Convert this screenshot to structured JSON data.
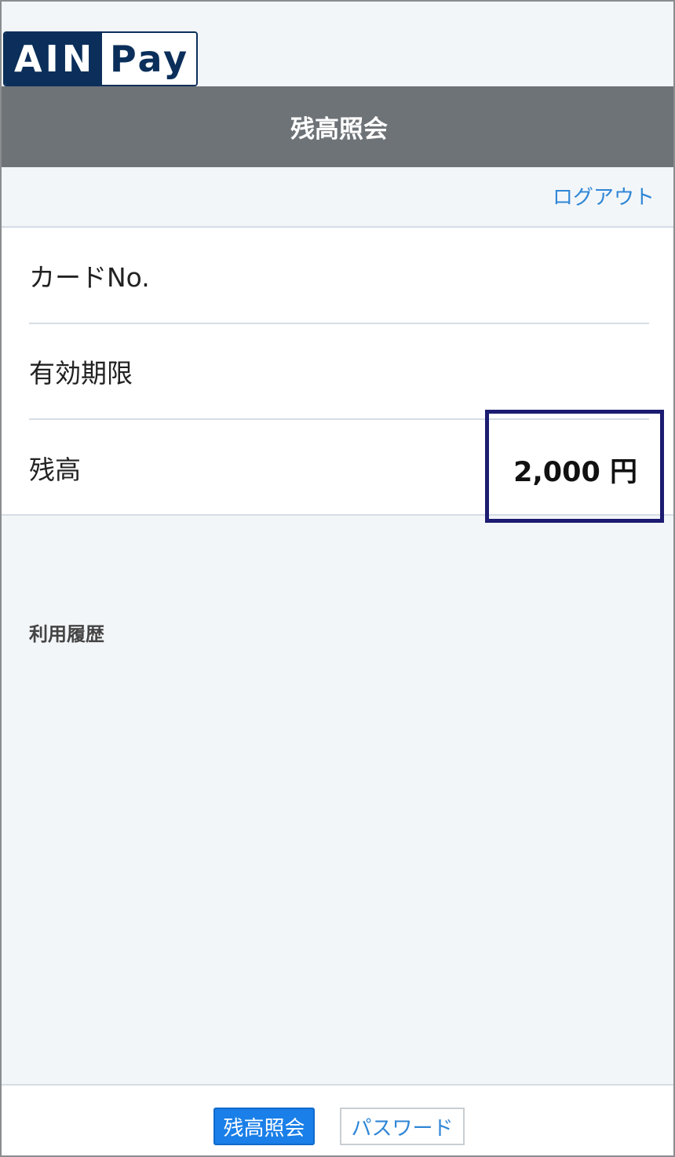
{
  "logo": {
    "left_text": "AIN",
    "right_text": "Pay"
  },
  "header": {
    "title": "残高照会"
  },
  "logout_label": "ログアウト",
  "card": {
    "card_no_label": "カードNo.",
    "expiry_label": "有効期限",
    "balance_label": "残高",
    "balance_value": "2,000 円"
  },
  "history": {
    "label": "利用履歴"
  },
  "footer": {
    "tabs": [
      {
        "label": "残高照会",
        "active": true
      },
      {
        "label": "パスワード",
        "active": false
      }
    ]
  },
  "colors": {
    "header_bg": "#6e7377",
    "link": "#2f86d6",
    "active_button": "#1a7fe8",
    "highlight_box": "#1c1c72",
    "logo_navy": "#0b2f5a"
  }
}
